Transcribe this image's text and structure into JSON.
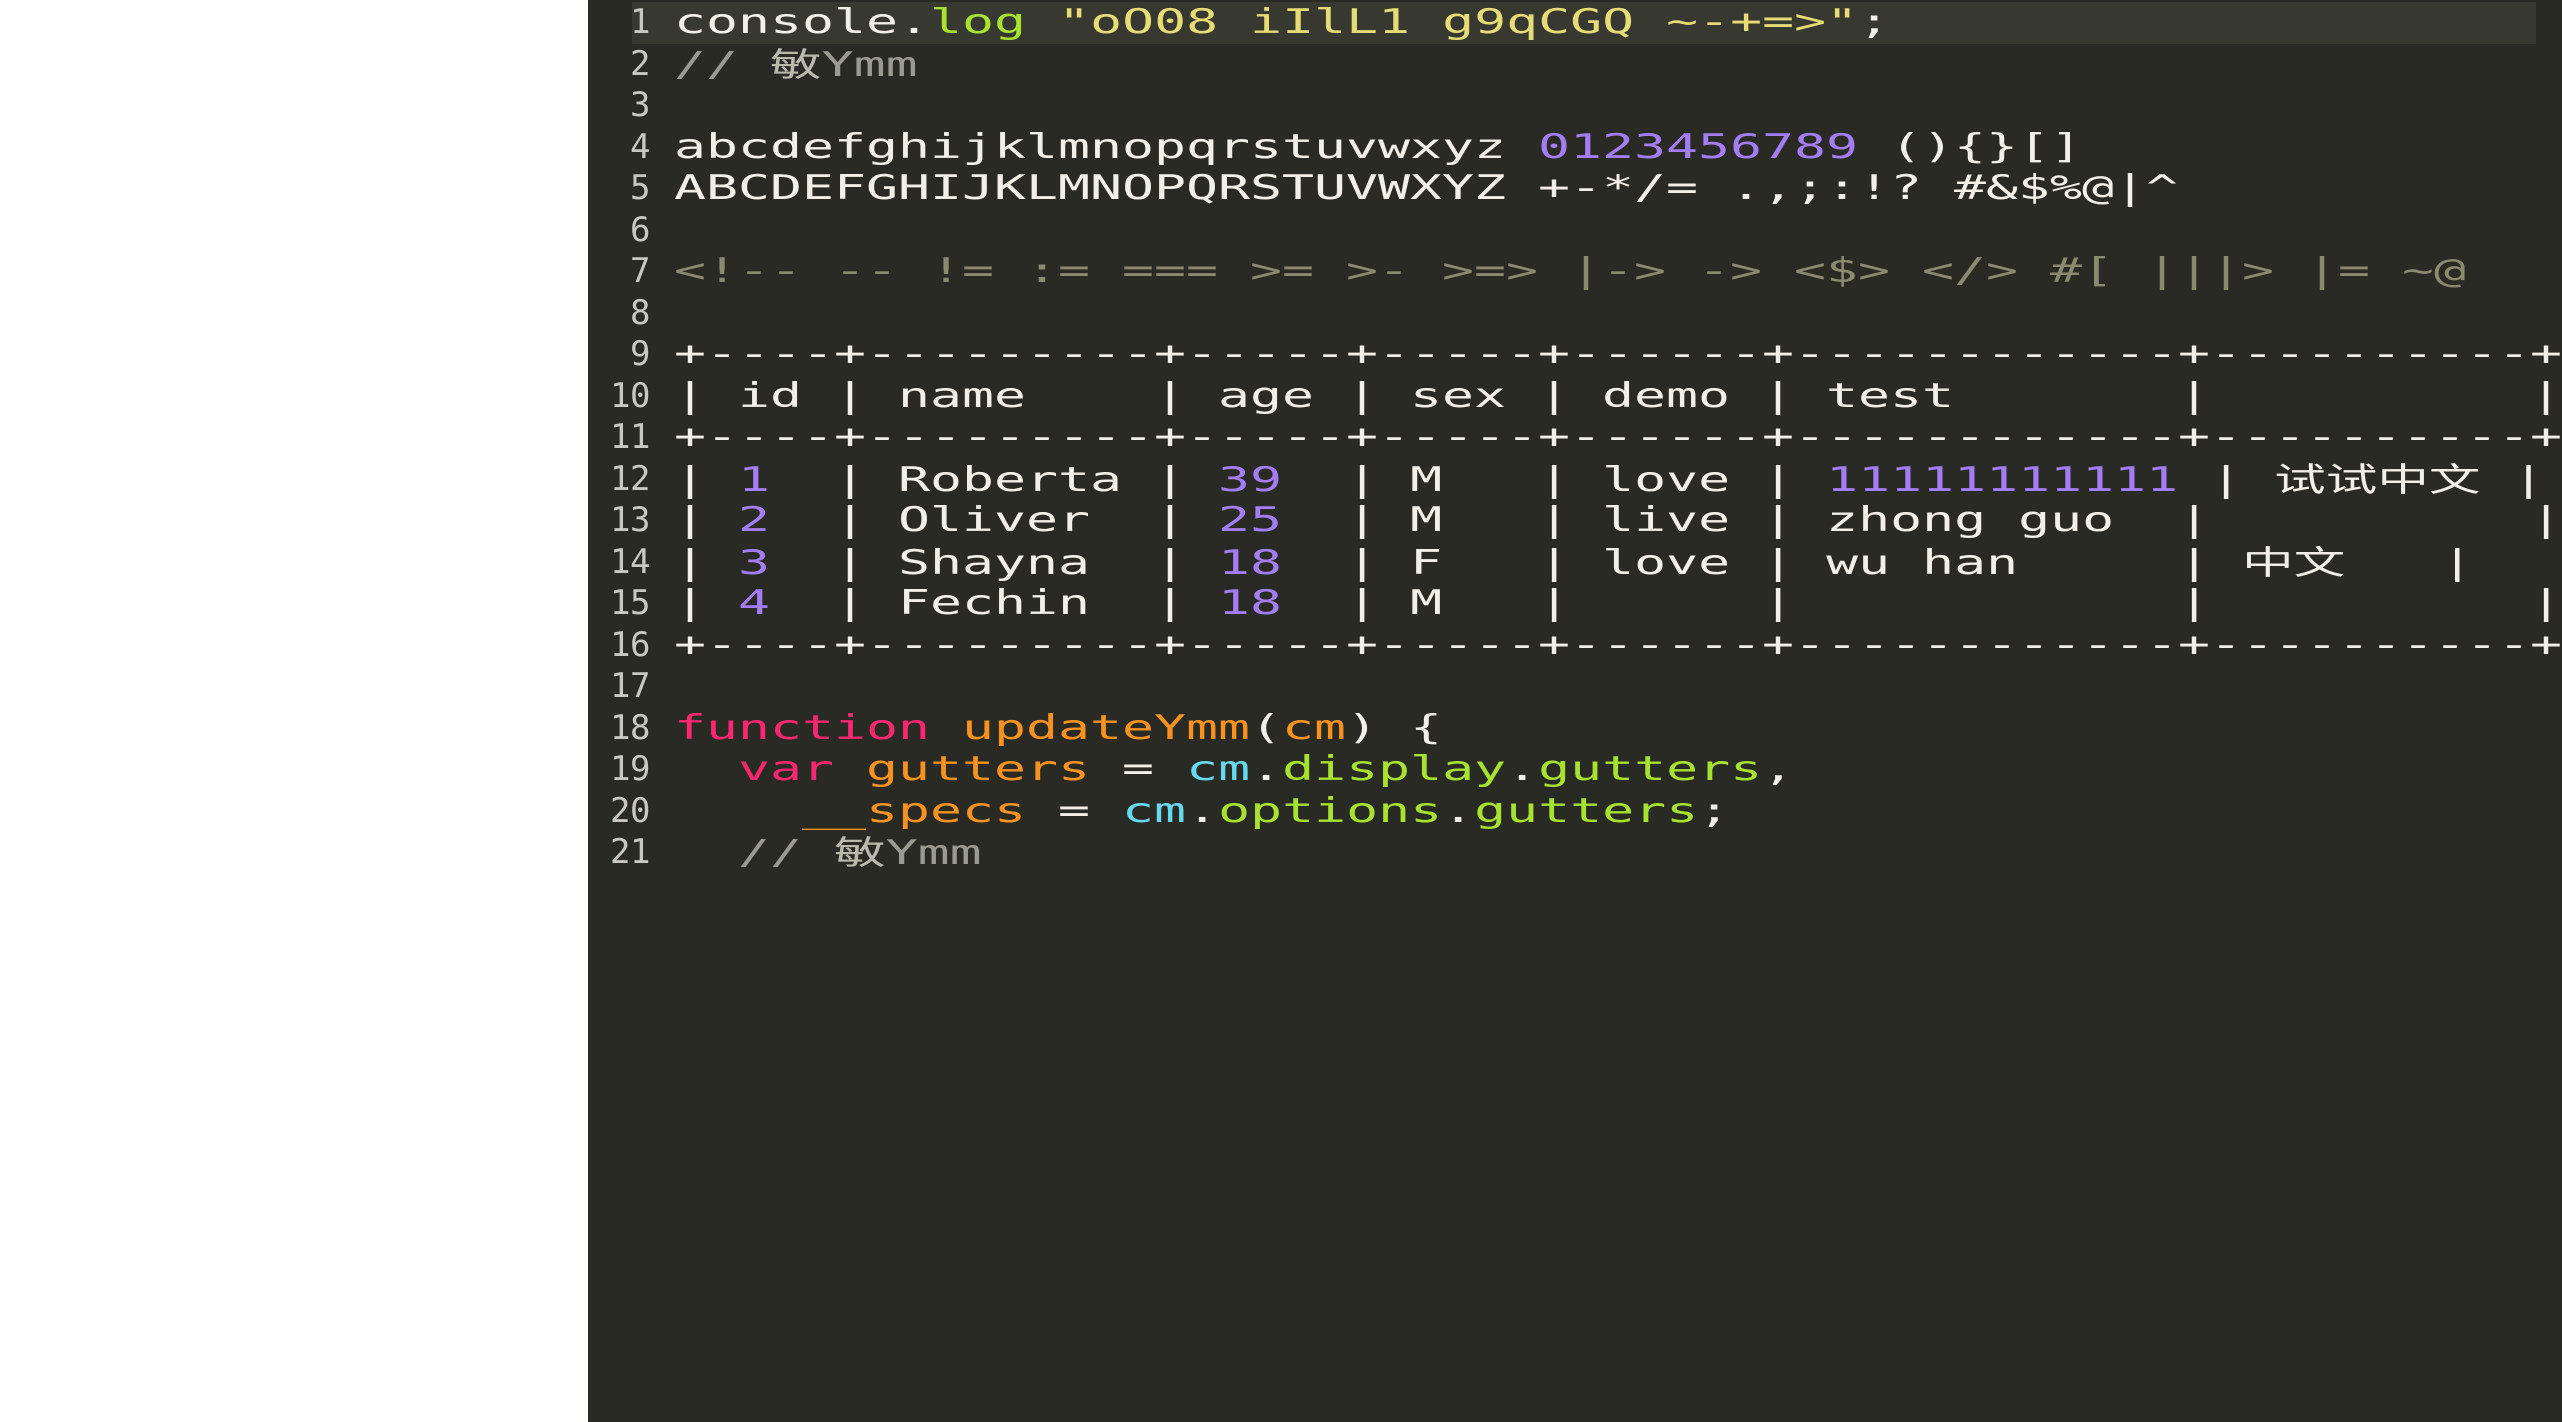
{
  "editor": {
    "theme_name": "monokai-dark",
    "background": "#292a24",
    "page_background": "#ffffff",
    "active_line_background": "#373830",
    "gutter_color": "#c8c8c0",
    "active_line": 1,
    "first_line_number": 1,
    "last_line_number": 21,
    "colors": {
      "plain": "#f2f0e6",
      "keyword": "#f92672",
      "function": "#f7921e",
      "string": "#e6db74",
      "number": "#a47df5",
      "comment": "#9a9a90",
      "property": "#a6e22e",
      "variable": "#66d9ef",
      "ligature": "#8a8a6e"
    },
    "line_numbers": [
      "1",
      "2",
      "3",
      "4",
      "5",
      "6",
      "7",
      "8",
      "9",
      "10",
      "11",
      "12",
      "13",
      "14",
      "15",
      "16",
      "17",
      "18",
      "19",
      "20",
      "21"
    ],
    "lines": [
      {
        "n": "1",
        "active": true,
        "tokens": [
          {
            "text": "console",
            "type": "plain"
          },
          {
            "text": ".",
            "type": "plain"
          },
          {
            "text": "log",
            "type": "property"
          },
          {
            "text": " ",
            "type": "plain"
          },
          {
            "text": "\"oO08 iIlL1 g9qCGQ ~-+=>\"",
            "type": "string"
          },
          {
            "text": ";",
            "type": "plain"
          }
        ]
      },
      {
        "n": "2",
        "active": false,
        "tokens": [
          {
            "text": "// ",
            "type": "comment"
          },
          {
            "text": "敏",
            "type": "comment-cjk"
          },
          {
            "text": "Ymm",
            "type": "comment"
          }
        ]
      },
      {
        "n": "3",
        "active": false,
        "tokens": []
      },
      {
        "n": "4",
        "active": false,
        "tokens": [
          {
            "text": "abcdefghijklmnopqrstuvwxyz ",
            "type": "plain"
          },
          {
            "text": "0123456789",
            "type": "number"
          },
          {
            "text": " (){}[]",
            "type": "plain"
          }
        ]
      },
      {
        "n": "5",
        "active": false,
        "tokens": [
          {
            "text": "ABCDEFGHIJKLMNOPQRSTUVWXYZ +-*/= .,;:!? #&$%@|^",
            "type": "plain"
          }
        ]
      },
      {
        "n": "6",
        "active": false,
        "tokens": []
      },
      {
        "n": "7",
        "active": false,
        "tokens": [
          {
            "text": "<!-- -- != := === >= >- >=> |-> -> <$> </> #[ |||> |= ~@",
            "type": "ligature"
          }
        ]
      },
      {
        "n": "8",
        "active": false,
        "tokens": []
      },
      {
        "n": "9",
        "active": false,
        "tokens": [
          {
            "text": "+----+---------+-----+-----+------+------------+----------+",
            "type": "plain"
          }
        ]
      },
      {
        "n": "10",
        "active": false,
        "tokens": [
          {
            "text": "| id | name    | age | sex | demo | test       |          |",
            "type": "plain"
          }
        ]
      },
      {
        "n": "11",
        "active": false,
        "tokens": [
          {
            "text": "+----+---------+-----+-----+------+------------+----------+",
            "type": "plain"
          }
        ]
      },
      {
        "n": "12",
        "active": false,
        "tokens": [
          {
            "text": "| ",
            "type": "plain"
          },
          {
            "text": "1",
            "type": "number"
          },
          {
            "text": "  | Roberta | ",
            "type": "plain"
          },
          {
            "text": "39",
            "type": "number"
          },
          {
            "text": "  | M   | love | ",
            "type": "plain"
          },
          {
            "text": "11111111111",
            "type": "number"
          },
          {
            "text": " | ",
            "type": "plain"
          },
          {
            "text": "试试中文",
            "type": "plain-cjk"
          },
          {
            "text": " |",
            "type": "plain"
          }
        ]
      },
      {
        "n": "13",
        "active": false,
        "tokens": [
          {
            "text": "| ",
            "type": "plain"
          },
          {
            "text": "2",
            "type": "number"
          },
          {
            "text": "  | Oliver  | ",
            "type": "plain"
          },
          {
            "text": "25",
            "type": "number"
          },
          {
            "text": "  | M   | live | zhong guo  |          |",
            "type": "plain"
          }
        ]
      },
      {
        "n": "14",
        "active": false,
        "tokens": [
          {
            "text": "| ",
            "type": "plain"
          },
          {
            "text": "3",
            "type": "number"
          },
          {
            "text": "  | Shayna  | ",
            "type": "plain"
          },
          {
            "text": "18",
            "type": "number"
          },
          {
            "text": "  | F   | love | wu han     | ",
            "type": "plain"
          },
          {
            "text": "中文",
            "type": "plain-cjk"
          },
          {
            "text": "   |",
            "type": "plain"
          }
        ]
      },
      {
        "n": "15",
        "active": false,
        "tokens": [
          {
            "text": "| ",
            "type": "plain"
          },
          {
            "text": "4",
            "type": "number"
          },
          {
            "text": "  | Fechin  | ",
            "type": "plain"
          },
          {
            "text": "18",
            "type": "number"
          },
          {
            "text": "  | M   |      |            |          |",
            "type": "plain"
          }
        ]
      },
      {
        "n": "16",
        "active": false,
        "tokens": [
          {
            "text": "+----+---------+-----+-----+------+------------+----------+",
            "type": "plain"
          }
        ]
      },
      {
        "n": "17",
        "active": false,
        "tokens": []
      },
      {
        "n": "18",
        "active": false,
        "tokens": [
          {
            "text": "function ",
            "type": "keyword"
          },
          {
            "text": "updateYmm",
            "type": "function"
          },
          {
            "text": "(",
            "type": "plain"
          },
          {
            "text": "cm",
            "type": "function"
          },
          {
            "text": ") {",
            "type": "plain"
          }
        ]
      },
      {
        "n": "19",
        "active": false,
        "tokens": [
          {
            "text": "  ",
            "type": "plain"
          },
          {
            "text": "var ",
            "type": "keyword"
          },
          {
            "text": "gutters",
            "type": "function"
          },
          {
            "text": " = ",
            "type": "plain"
          },
          {
            "text": "cm",
            "type": "variable"
          },
          {
            "text": ".",
            "type": "plain"
          },
          {
            "text": "display",
            "type": "property"
          },
          {
            "text": ".",
            "type": "plain"
          },
          {
            "text": "gutters",
            "type": "property"
          },
          {
            "text": ",",
            "type": "plain"
          }
        ]
      },
      {
        "n": "20",
        "active": false,
        "tokens": [
          {
            "text": "    ",
            "type": "plain"
          },
          {
            "text": "__specs",
            "type": "function"
          },
          {
            "text": " = ",
            "type": "plain"
          },
          {
            "text": "cm",
            "type": "variable"
          },
          {
            "text": ".",
            "type": "plain"
          },
          {
            "text": "options",
            "type": "property"
          },
          {
            "text": ".",
            "type": "plain"
          },
          {
            "text": "gutters",
            "type": "property"
          },
          {
            "text": ";",
            "type": "plain"
          }
        ]
      },
      {
        "n": "21",
        "active": false,
        "tokens": [
          {
            "text": "  // ",
            "type": "comment"
          },
          {
            "text": "敏",
            "type": "comment-cjk"
          },
          {
            "text": "Ymm",
            "type": "comment"
          }
        ]
      }
    ]
  }
}
